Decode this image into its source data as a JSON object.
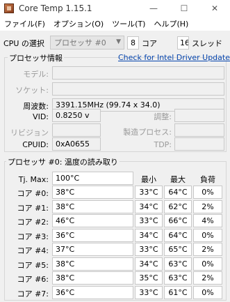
{
  "window": {
    "title": "Core Temp 1.15.1",
    "controls": [
      "—",
      "☐",
      "✕"
    ]
  },
  "menu": [
    "ファイル(F)",
    "オプション(O)",
    "ツール(T)",
    "ヘルプ(H)"
  ],
  "cpu_select": {
    "label": "CPU の選択",
    "processor": "プロセッサ #0",
    "cores_value": "8",
    "cores_label": "コア",
    "threads_value": "16",
    "threads_label": "スレッド"
  },
  "info": {
    "title": "プロセッサ情報",
    "driver_link": "Check for Intel Driver Updates",
    "model_label": "モデル:",
    "model_value": "",
    "socket_label": "ソケット:",
    "socket_value": "",
    "freq_label": "周波数:",
    "freq_value": "3391.15MHz (99.74 x 34.0)",
    "vid_label": "VID:",
    "vid_value": "0.8250 v",
    "adjust_label": "調整:",
    "adjust_value": "",
    "revision_label": "リビジョン",
    "revision_value": "",
    "process_label": "製造プロセス:",
    "process_value": "",
    "cpuid_label": "CPUID:",
    "cpuid_value": "0xA0655",
    "tdp_label": "TDP:",
    "tdp_value": ""
  },
  "temps": {
    "title": "プロセッサ #0: 温度の読み取り",
    "tj_label": "Tj. Max:",
    "tj_value": "100°C",
    "col_min": "最小",
    "col_max": "最大",
    "col_load": "負荷",
    "rows": [
      {
        "label": "コア #0:",
        "temp": "38°C",
        "min": "33°C",
        "max": "64°C",
        "load": "0%"
      },
      {
        "label": "コア #1:",
        "temp": "38°C",
        "min": "34°C",
        "max": "62°C",
        "load": "2%"
      },
      {
        "label": "コア #2:",
        "temp": "46°C",
        "min": "33°C",
        "max": "66°C",
        "load": "4%"
      },
      {
        "label": "コア #3:",
        "temp": "36°C",
        "min": "34°C",
        "max": "64°C",
        "load": "0%"
      },
      {
        "label": "コア #4:",
        "temp": "37°C",
        "min": "33°C",
        "max": "65°C",
        "load": "2%"
      },
      {
        "label": "コア #5:",
        "temp": "38°C",
        "min": "34°C",
        "max": "63°C",
        "load": "0%"
      },
      {
        "label": "コア #6:",
        "temp": "38°C",
        "min": "35°C",
        "max": "63°C",
        "load": "2%"
      },
      {
        "label": "コア #7:",
        "temp": "36°C",
        "min": "33°C",
        "max": "61°C",
        "load": "0%"
      }
    ]
  }
}
